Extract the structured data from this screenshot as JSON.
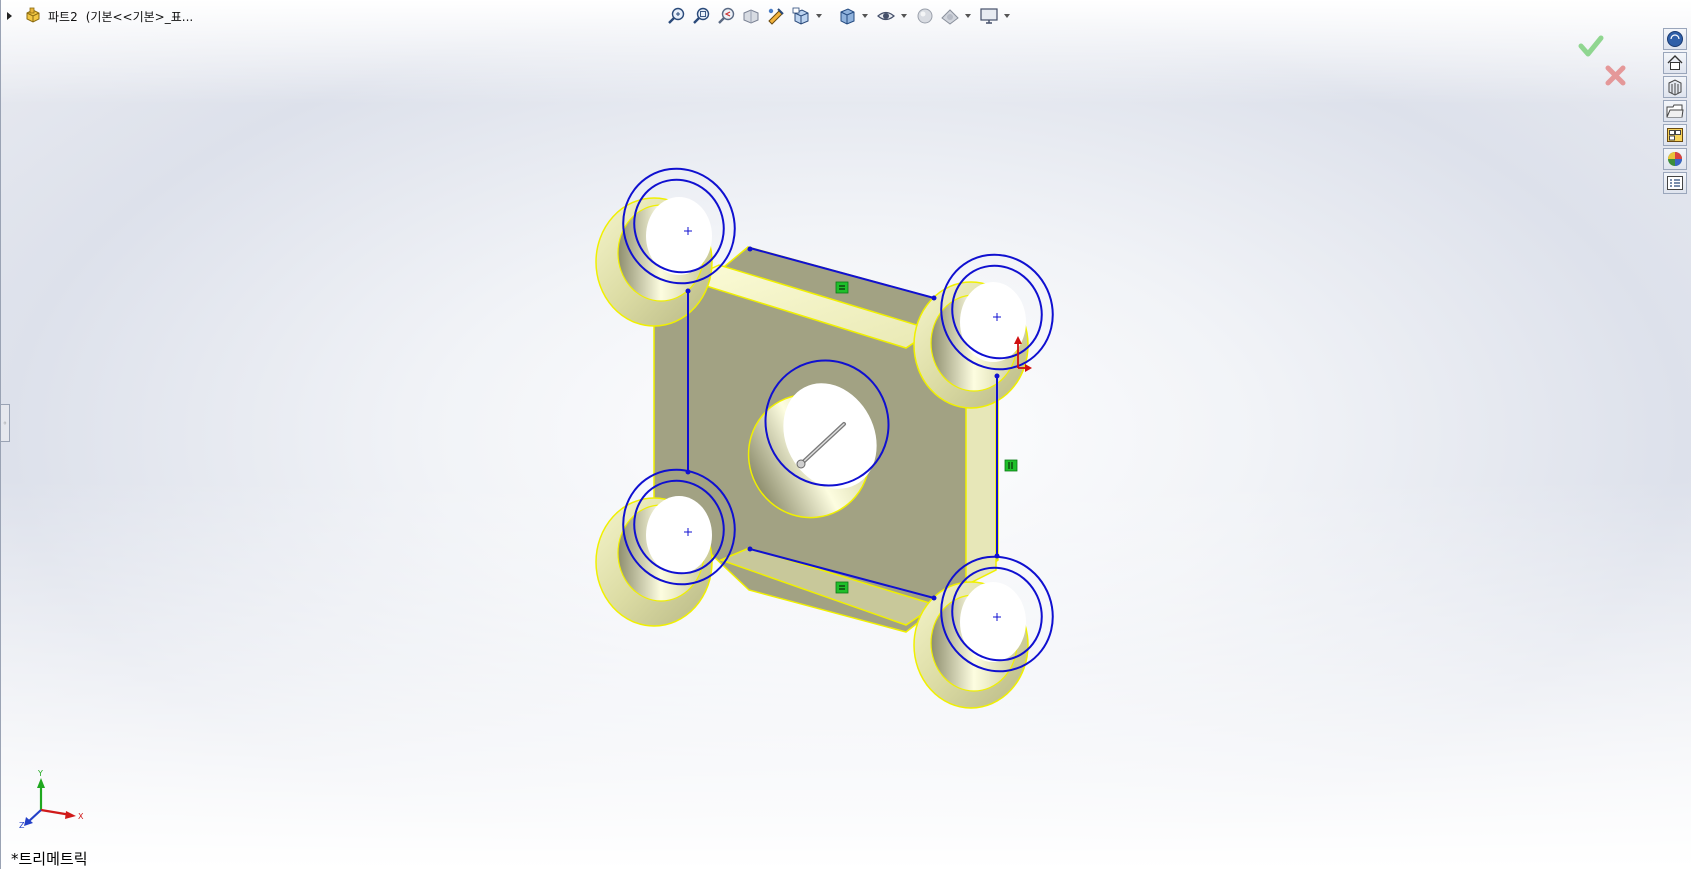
{
  "feature_tree": {
    "part_name": "파트2",
    "config_text": "(기본<<기본>_표..."
  },
  "hud_toolbar": {
    "icons": [
      "zoom-to-fit-icon",
      "zoom-to-area-icon",
      "previous-view-icon",
      "section-view-icon",
      "dynamic-annotation-icon",
      "view-orientation-icon",
      "display-style-icon",
      "hide-show-items-icon",
      "edit-appearance-icon",
      "apply-scene-icon",
      "view-settings-icon"
    ]
  },
  "sketch_relations": [
    "horizontal",
    "vertical",
    "horizontal"
  ],
  "colors": {
    "sketch": "#1010d0",
    "face_highlight": "#f0f000",
    "relation_badge": "#1fbf2a",
    "confirm": "#7ed07e",
    "cancel": "#e48a8a"
  },
  "task_pane": {
    "icons": [
      "solidworks-resources-icon",
      "home-icon",
      "design-library-icon",
      "file-explorer-icon",
      "view-palette-icon",
      "appearances-icon",
      "custom-properties-icon"
    ]
  },
  "view_label": "*트리메트릭",
  "triad": {
    "x": "X",
    "y": "Y",
    "z": "Z"
  }
}
